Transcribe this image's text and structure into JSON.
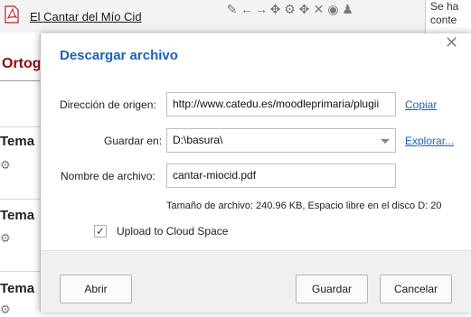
{
  "background": {
    "file_link": "El Cantar del Mío Cid",
    "edit_icons": [
      "pencil-icon",
      "arrow-left-icon",
      "arrow-right-icon",
      "move-icon",
      "gear-icon",
      "move-icon",
      "delete-icon",
      "eye-icon",
      "person-icon"
    ],
    "right_panel_text_1": "Se ha",
    "right_panel_text_2": "conte",
    "section_title": "Ortog",
    "tema_items": [
      "Tema",
      "Tema",
      "Tema"
    ]
  },
  "dialog": {
    "title": "Descargar archivo",
    "source_label": "Dirección de origen:",
    "source_value": "http://www.catedu.es/moodleprimaria/plugii",
    "copy_link": "Copiar",
    "save_in_label": "Guardar en:",
    "save_in_value": "D:\\basura\\",
    "browse_link": "Explorar...",
    "filename_label": "Nombre de archivo:",
    "filename_value": "cantar-miocid.pdf",
    "file_info": "Tamaño de archivo: 240.96 KB, Espacio libre en el disco D: 20",
    "upload_checked": true,
    "upload_label": "Upload to Cloud Space",
    "open_button": "Abrir",
    "save_button": "Guardar",
    "cancel_button": "Cancelar"
  }
}
